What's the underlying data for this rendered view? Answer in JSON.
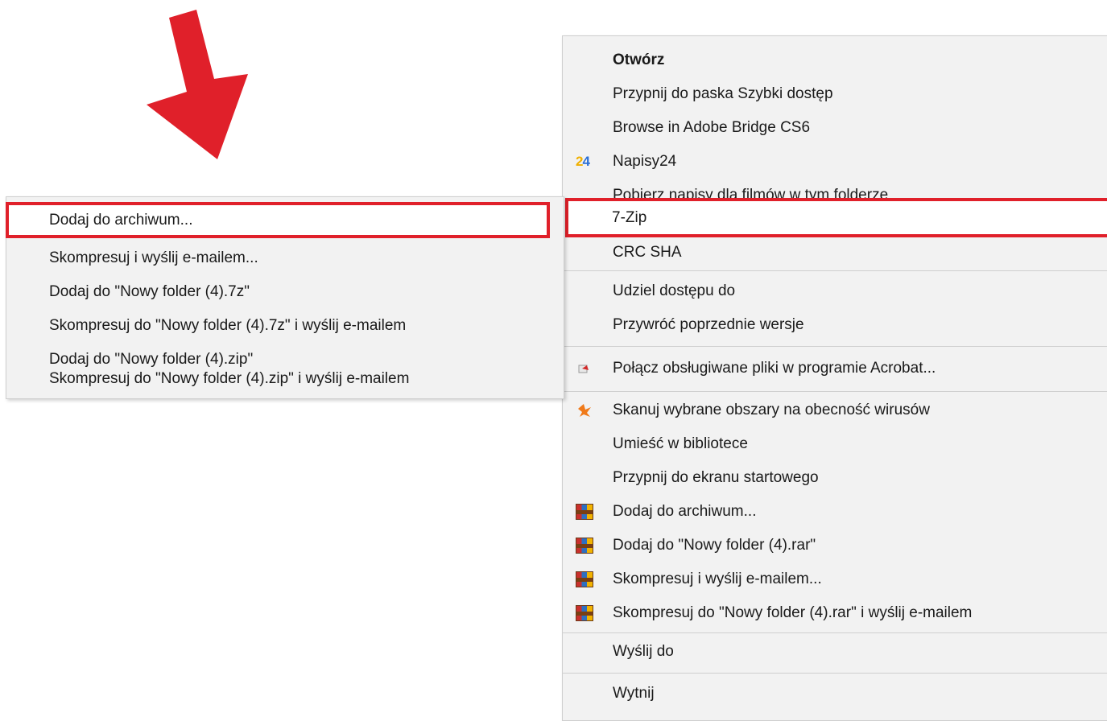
{
  "main_menu": {
    "items": [
      {
        "label": "Otwórz"
      },
      {
        "label": "Przypnij do paska Szybki dostęp"
      },
      {
        "label": "Browse in Adobe Bridge CS6"
      },
      {
        "label": "Napisy24",
        "icon": "napisy24-icon"
      },
      {
        "label": "Pobierz napisy dla filmów w tym folderze"
      },
      {
        "label": "7-Zip",
        "has_submenu": true
      },
      {
        "label": "CRC SHA",
        "has_submenu": true
      },
      {
        "label": "Udziel dostępu do",
        "has_submenu": true
      },
      {
        "label": "Przywróć poprzednie wersje"
      },
      {
        "label": "Połącz obsługiwane pliki w programie Acrobat...",
        "icon": "acrobat-icon"
      },
      {
        "label": "Skanuj wybrane obszary na obecność wirusów",
        "icon": "avast-icon"
      },
      {
        "label": "Umieść w bibliotece",
        "has_submenu": true
      },
      {
        "label": "Przypnij do ekranu startowego"
      },
      {
        "label": "Dodaj do archiwum...",
        "icon": "winrar-icon"
      },
      {
        "label": "Dodaj do \"Nowy folder (4).rar\"",
        "icon": "winrar-icon"
      },
      {
        "label": "Skompresuj i wyślij e-mailem...",
        "icon": "winrar-icon"
      },
      {
        "label": "Skompresuj do \"Nowy folder (4).rar\" i wyślij e-mailem",
        "icon": "winrar-icon"
      },
      {
        "label": "Wyślij do",
        "has_submenu": true
      },
      {
        "label": "Wytnij"
      }
    ]
  },
  "sub_menu": {
    "items": [
      {
        "label": "Dodaj do archiwum..."
      },
      {
        "label": "Skompresuj i wyślij e-mailem..."
      },
      {
        "label": "Dodaj do \"Nowy folder (4).7z\""
      },
      {
        "label": "Skompresuj do \"Nowy folder (4).7z\" i wyślij e-mailem"
      },
      {
        "label": "Dodaj do \"Nowy folder (4).zip\""
      },
      {
        "label": "Skompresuj do \"Nowy folder (4).zip\" i wyślij e-mailem"
      }
    ]
  },
  "colors": {
    "highlight_border": "#e0202a",
    "arrow": "#e0202a",
    "menu_bg": "#f2f2f2"
  }
}
